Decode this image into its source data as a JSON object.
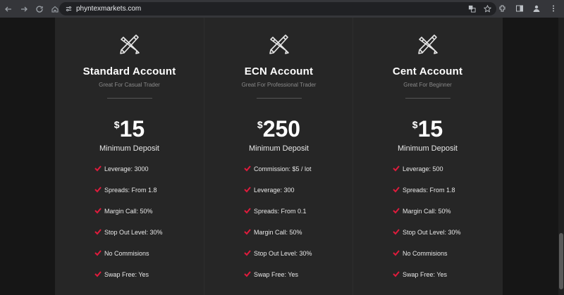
{
  "browser": {
    "url": "phyntexmarkets.com"
  },
  "colors": {
    "accent_check": "#e01b3c",
    "panel_bg": "#262626",
    "page_bg": "#161616"
  },
  "plans": [
    {
      "title": "Standard Account",
      "subtitle": "Great For Casual Trader",
      "currency": "$",
      "amount": "15",
      "min_label": "Minimum Deposit",
      "features": [
        "Leverage: 3000",
        "Spreads: From 1.8",
        "Margin Call: 50%",
        "Stop Out Level: 30%",
        "No Commisions",
        "Swap Free: Yes"
      ]
    },
    {
      "title": "ECN Account",
      "subtitle": "Great For Professional Trader",
      "currency": "$",
      "amount": "250",
      "min_label": "Minimum Deposit",
      "features": [
        "Commission: $5 / lot",
        "Leverage: 300",
        "Spreads: From 0.1",
        "Margin Call: 50%",
        "Stop Out Level: 30%",
        "Swap Free: Yes"
      ]
    },
    {
      "title": "Cent Account",
      "subtitle": "Great For Beginner",
      "currency": "$",
      "amount": "15",
      "min_label": "Minimum Deposit",
      "features": [
        "Leverage: 500",
        "Spreads: From 1.8",
        "Margin Call: 50%",
        "Stop Out Level: 30%",
        "No Commisions",
        "Swap Free: Yes"
      ]
    }
  ]
}
